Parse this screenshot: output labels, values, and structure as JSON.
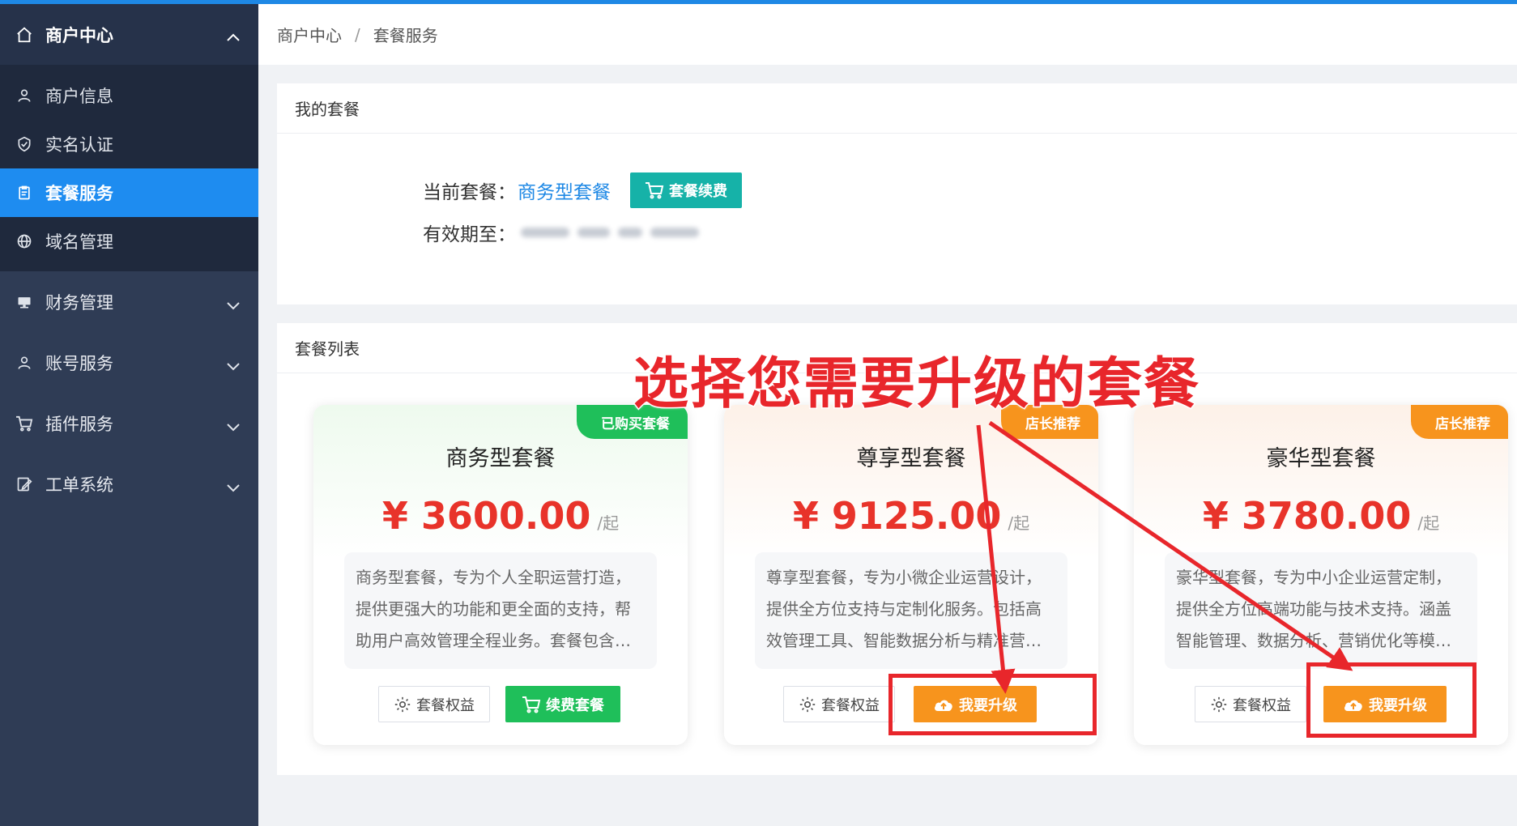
{
  "sidebar": {
    "header": {
      "label": "商户中心",
      "icon": "home-icon"
    },
    "sub_items": [
      {
        "label": "商户信息",
        "icon": "user-icon",
        "active": false
      },
      {
        "label": "实名认证",
        "icon": "shield-check-icon",
        "active": false
      },
      {
        "label": "套餐服务",
        "icon": "clipboard-icon",
        "active": true
      },
      {
        "label": "域名管理",
        "icon": "globe-icon",
        "active": false
      }
    ],
    "groups": [
      {
        "label": "财务管理",
        "icon": "finance-icon"
      },
      {
        "label": "账号服务",
        "icon": "user-icon"
      },
      {
        "label": "插件服务",
        "icon": "cart-icon"
      },
      {
        "label": "工单系统",
        "icon": "ticket-edit-icon"
      }
    ]
  },
  "breadcrumb": {
    "root": "商户中心",
    "separator": "/",
    "current": "套餐服务"
  },
  "my_plan": {
    "title": "我的套餐",
    "current_label": "当前套餐：",
    "current_plan": "商务型套餐",
    "renew_button": "套餐续费",
    "expiry_label": "有效期至："
  },
  "plan_list": {
    "title": "套餐列表",
    "cards": [
      {
        "ribbon": "已购买套餐",
        "name": "商务型套餐",
        "price": "¥ 3600.00",
        "unit": "/起",
        "description": "商务型套餐，专为个人全职运营打造，提供更强大的功能和更全面的支持，帮助用户高效管理全程业务。套餐包含…",
        "benefits_button": "套餐权益",
        "action_button": "续费套餐"
      },
      {
        "ribbon": "店长推荐",
        "name": "尊享型套餐",
        "price": "¥ 9125.00",
        "unit": "/起",
        "description": "尊享型套餐，专为小微企业运营设计，提供全方位支持与定制化服务。包括高效管理工具、智能数据分析与精准营…",
        "benefits_button": "套餐权益",
        "action_button": "我要升级"
      },
      {
        "ribbon": "店长推荐",
        "name": "豪华型套餐",
        "price": "¥ 3780.00",
        "unit": "/起",
        "description": "豪华型套餐，专为中小企业运营定制，提供全方位高端功能与技术支持。涵盖智能管理、数据分析、营销优化等模…",
        "benefits_button": "套餐权益",
        "action_button": "我要升级"
      }
    ]
  },
  "annotation": {
    "text": "选择您需要升级的套餐",
    "color": "#e8262b"
  },
  "colors": {
    "accent": "#1e8cf0",
    "sidebar": "#2f3c55",
    "price": "#e8332a",
    "green": "#1fbf5a",
    "orange": "#f7941d",
    "teal": "#16b2a8"
  }
}
